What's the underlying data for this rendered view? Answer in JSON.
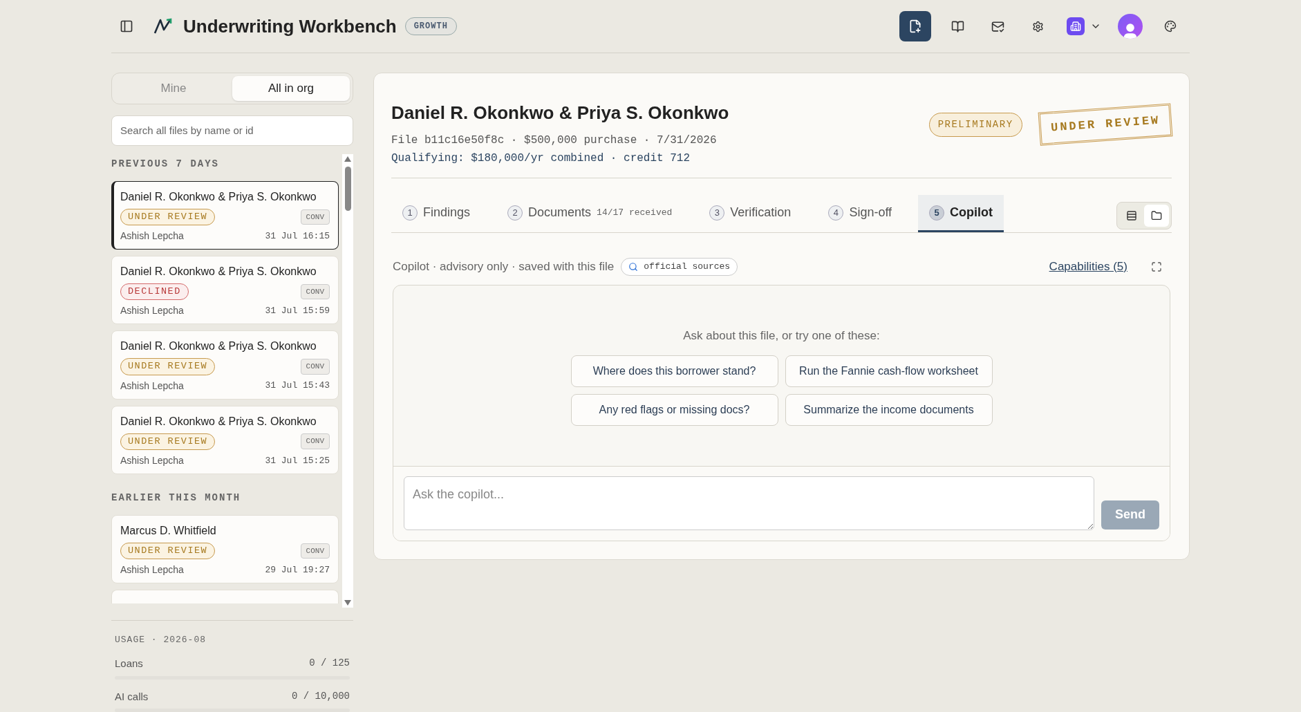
{
  "header": {
    "title": "Underwriting Workbench",
    "plan": "GROWTH",
    "toolbar": [
      {
        "kind": "new-file",
        "selected": true
      },
      {
        "kind": "book",
        "selected": false
      },
      {
        "kind": "mail",
        "selected": false
      },
      {
        "kind": "settings",
        "selected": false
      },
      {
        "kind": "workspace",
        "selected": false
      },
      {
        "kind": "avatar",
        "selected": false
      },
      {
        "kind": "palette",
        "selected": false
      }
    ]
  },
  "sidebar": {
    "scope_tabs": [
      {
        "label": "Mine",
        "selected": false
      },
      {
        "label": "All in org",
        "selected": true
      }
    ],
    "search": {
      "placeholder": "Search all files by name or id"
    },
    "groups": [
      {
        "heading": "PREVIOUS 7 DAYS",
        "files": [
          {
            "name": "Daniel R. Okonkwo & Priya S. Okonkwo",
            "status": "UNDER REVIEW",
            "kind": "review",
            "type": "CONV",
            "owner": "Ashish Lepcha",
            "time": "31 Jul 16:15",
            "selected": true
          },
          {
            "name": "Daniel R. Okonkwo & Priya S. Okonkwo",
            "status": "DECLINED",
            "kind": "declined",
            "type": "CONV",
            "owner": "Ashish Lepcha",
            "time": "31 Jul 15:59",
            "selected": false
          },
          {
            "name": "Daniel R. Okonkwo & Priya S. Okonkwo",
            "status": "UNDER REVIEW",
            "kind": "review",
            "type": "CONV",
            "owner": "Ashish Lepcha",
            "time": "31 Jul 15:43",
            "selected": false
          },
          {
            "name": "Daniel R. Okonkwo & Priya S. Okonkwo",
            "status": "UNDER REVIEW",
            "kind": "review",
            "type": "CONV",
            "owner": "Ashish Lepcha",
            "time": "31 Jul 15:25",
            "selected": false
          }
        ]
      },
      {
        "heading": "EARLIER THIS MONTH",
        "files": [
          {
            "name": "Marcus D. Whitfield",
            "status": "UNDER REVIEW",
            "kind": "review",
            "type": "CONV",
            "owner": "Ashish Lepcha",
            "time": "29 Jul 19:27",
            "selected": false
          },
          {
            "kind": "clipped"
          }
        ]
      }
    ],
    "usage": {
      "heading": "USAGE · 2026-08",
      "meters": [
        {
          "label": "Loans",
          "reading": "0 / 125",
          "level": 0
        },
        {
          "label": "AI calls",
          "reading": "0 / 10,000",
          "level": 0
        }
      ]
    }
  },
  "file": {
    "title": "Daniel R. Okonkwo & Priya S. Okonkwo",
    "meta": "File b11c16e50f8c · $500,000 purchase · 7/31/2026",
    "qualifying": "Qualifying: $180,000/yr combined · credit 712",
    "badge": "PRELIMINARY",
    "stamp": "UNDER REVIEW",
    "tabs": [
      {
        "number": "1",
        "label": "Findings",
        "selected": false
      },
      {
        "number": "2",
        "label": "Documents",
        "note": "14/17 received",
        "selected": false
      },
      {
        "number": "3",
        "label": "Verification",
        "selected": false
      },
      {
        "number": "4",
        "label": "Sign-off",
        "selected": false
      },
      {
        "number": "5",
        "label": "Copilot",
        "selected": true
      }
    ],
    "view_toggle": [
      {
        "kind": "rows",
        "selected": false
      },
      {
        "kind": "folder",
        "selected": true
      }
    ]
  },
  "copilot": {
    "note": "Copilot · advisory only · saved with this file",
    "sources": "official sources",
    "capabilities": "Capabilities (5)",
    "prompt": "Ask about this file, or try one of these:",
    "suggestions": [
      "Where does this borrower stand?",
      "Run the Fannie cash-flow worksheet",
      "Any red flags or missing docs?",
      "Summarize the income documents"
    ],
    "input": {
      "placeholder": "Ask the copilot..."
    },
    "send": {
      "label": "Send",
      "disabled": true
    }
  }
}
